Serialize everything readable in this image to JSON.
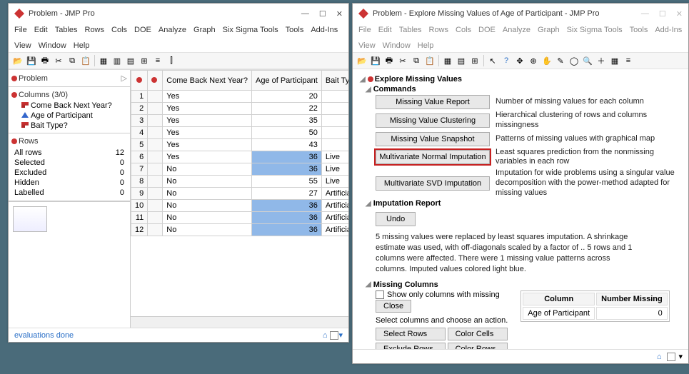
{
  "win1": {
    "title": "Problem - JMP Pro",
    "menu": [
      "File",
      "Edit",
      "Tables",
      "Rows",
      "Cols",
      "DOE",
      "Analyze",
      "Graph",
      "Six Sigma Tools",
      "Tools",
      "Add-Ins",
      "View",
      "Window",
      "Help"
    ],
    "source_label": "Problem",
    "columns_label": "Columns (3/0)",
    "columns": [
      "Come Back Next Year?",
      "Age of Participant",
      "Bait Type?"
    ],
    "rows_label": "Rows",
    "row_stats": {
      "All rows": "12",
      "Selected": "0",
      "Excluded": "0",
      "Hidden": "0",
      "Labelled": "0"
    },
    "headers": [
      "",
      "Come Back Next Year?",
      "Age of Participant",
      "Bait Type?"
    ],
    "rows": [
      {
        "n": 1,
        "c1": "Yes",
        "c2": "20",
        "c3": "",
        "imp": false
      },
      {
        "n": 2,
        "c1": "Yes",
        "c2": "22",
        "c3": "",
        "imp": false
      },
      {
        "n": 3,
        "c1": "Yes",
        "c2": "35",
        "c3": "",
        "imp": false
      },
      {
        "n": 4,
        "c1": "Yes",
        "c2": "50",
        "c3": "",
        "imp": false
      },
      {
        "n": 5,
        "c1": "Yes",
        "c2": "43",
        "c3": "",
        "imp": false
      },
      {
        "n": 6,
        "c1": "Yes",
        "c2": "36",
        "c3": "Live",
        "imp": true
      },
      {
        "n": 7,
        "c1": "No",
        "c2": "36",
        "c3": "Live",
        "imp": true
      },
      {
        "n": 8,
        "c1": "No",
        "c2": "55",
        "c3": "Live",
        "imp": false
      },
      {
        "n": 9,
        "c1": "No",
        "c2": "27",
        "c3": "Artificial",
        "imp": false
      },
      {
        "n": 10,
        "c1": "No",
        "c2": "36",
        "c3": "Artificial",
        "imp": true
      },
      {
        "n": 11,
        "c1": "No",
        "c2": "36",
        "c3": "Artificial",
        "imp": true
      },
      {
        "n": 12,
        "c1": "No",
        "c2": "36",
        "c3": "Artificial",
        "imp": true
      }
    ],
    "status": "evaluations done"
  },
  "win2": {
    "title": "Problem - Explore Missing Values of Age of Participant - JMP Pro",
    "menu": [
      "File",
      "Edit",
      "Tables",
      "Rows",
      "Cols",
      "DOE",
      "Analyze",
      "Graph",
      "Six Sigma Tools",
      "Tools",
      "Add-Ins",
      "View",
      "Window",
      "Help"
    ],
    "section_top": "Explore Missing Values",
    "section_commands": "Commands",
    "cmds": [
      {
        "label": "Missing Value Report",
        "desc": "Number of missing values for each column"
      },
      {
        "label": "Missing Value Clustering",
        "desc": "Hierarchical clustering of rows and columns missingness"
      },
      {
        "label": "Missing Value Snapshot",
        "desc": "Patterns of missing values with graphical map"
      },
      {
        "label": "Multivariate Normal Imputation",
        "desc": "Least squares prediction from the nonmissing variables in each row",
        "hl": true
      },
      {
        "label": "Multivariate SVD Imputation",
        "desc": "Imputation for wide problems using a singular value decomposition with the power-method adapted for missing values"
      }
    ],
    "section_report": "Imputation Report",
    "undo": "Undo",
    "report_text": "5 missing values were replaced by least squares imputation. A shrinkage estimate was used, with off-diagonals scaled by a factor of .. 5 rows and 1 columns were affected. There were 1 missing value patterns across columns. Imputed values colored light blue.",
    "section_missing": "Missing Columns",
    "show_only": "Show only columns with missing",
    "close": "Close",
    "select_prompt": "Select columns and choose an action.",
    "btns": [
      "Select Rows",
      "Color Cells",
      "Exclude Rows",
      "Color Rows"
    ],
    "mc_headers": [
      "Column",
      "Number Missing"
    ],
    "mc_row": [
      "Age of Participant",
      "0"
    ]
  }
}
